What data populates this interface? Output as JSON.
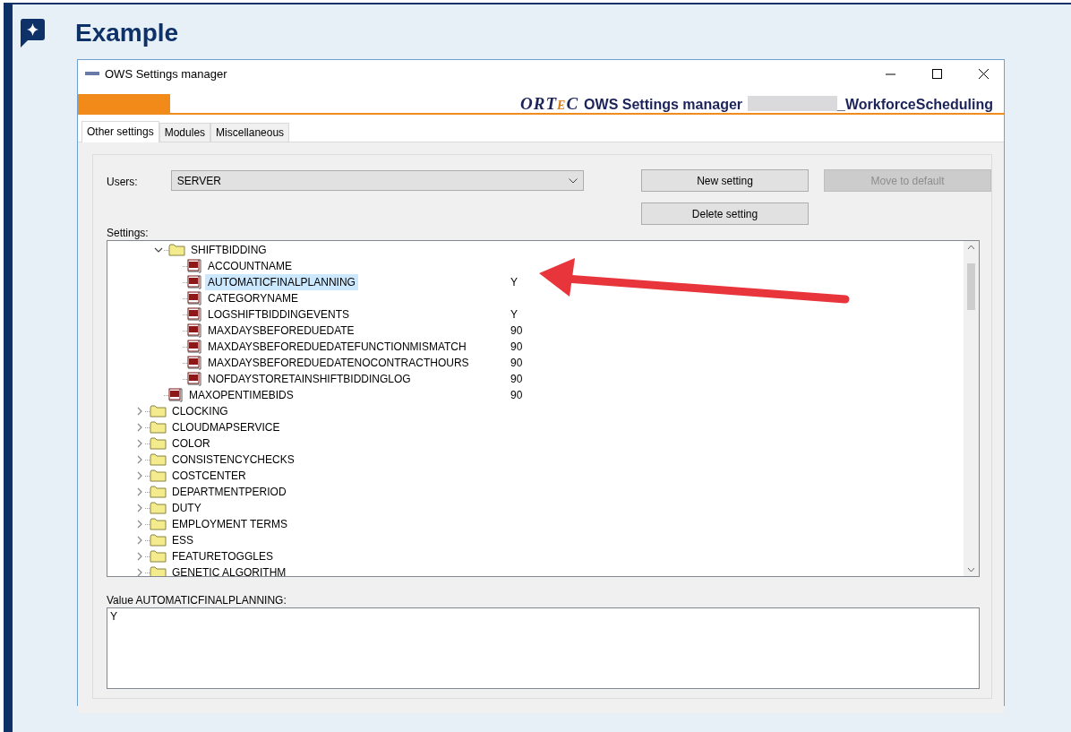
{
  "callout": {
    "title": "Example"
  },
  "window": {
    "title": "OWS Settings manager",
    "logo": "ORTEC",
    "header_title": "OWS Settings manager",
    "header_suffix": "_WorkforceScheduling"
  },
  "tabs": [
    {
      "label": "Other settings",
      "selected": true
    },
    {
      "label": "Modules",
      "selected": false
    },
    {
      "label": "Miscellaneous",
      "selected": false
    }
  ],
  "users": {
    "label": "Users:",
    "value": "SERVER"
  },
  "buttons": [
    {
      "label": "New setting",
      "disabled": false
    },
    {
      "label": "Move to default",
      "disabled": true
    },
    {
      "label": "Delete setting",
      "disabled": false
    }
  ],
  "settings": {
    "label": "Settings:",
    "tree": [
      {
        "kind": "hidden",
        "children": [
          {
            "kind": "folder",
            "label": "SHIFTBIDDING",
            "expanded": true,
            "selected": false,
            "children": [
              {
                "kind": "setting",
                "label": "ACCOUNTNAME",
                "selected": false
              },
              {
                "kind": "setting",
                "label": "AUTOMATICFINALPLANNING",
                "value": "Y",
                "selected": true
              },
              {
                "kind": "setting",
                "label": "CATEGORYNAME",
                "selected": false
              },
              {
                "kind": "setting",
                "label": "LOGSHIFTBIDDINGEVENTS",
                "value": "Y",
                "selected": false
              },
              {
                "kind": "setting",
                "label": "MAXDAYSBEFOREDUEDATE",
                "value": "90",
                "selected": false
              },
              {
                "kind": "setting",
                "label": "MAXDAYSBEFOREDUEDATEFUNCTIONMISMATCH",
                "value": "90",
                "selected": false
              },
              {
                "kind": "setting",
                "label": "MAXDAYSBEFOREDUEDATENOCONTRACTHOURS",
                "value": "90",
                "selected": false
              },
              {
                "kind": "setting",
                "label": "NOFDAYSTORETAINSHIFTBIDDINGLOG",
                "value": "90",
                "selected": false
              }
            ]
          },
          {
            "kind": "setting",
            "label": "MAXOPENTIMEBIDS",
            "value": "90",
            "selected": false
          }
        ]
      },
      {
        "kind": "folder",
        "label": "CLOCKING",
        "expanded": false,
        "selected": false
      },
      {
        "kind": "folder",
        "label": "CLOUDMAPSERVICE",
        "expanded": false,
        "selected": false
      },
      {
        "kind": "folder",
        "label": "COLOR",
        "expanded": false,
        "selected": false
      },
      {
        "kind": "folder",
        "label": "CONSISTENCYCHECKS",
        "expanded": false,
        "selected": false
      },
      {
        "kind": "folder",
        "label": "COSTCENTER",
        "expanded": false,
        "selected": false
      },
      {
        "kind": "folder",
        "label": "DEPARTMENTPERIOD",
        "expanded": false,
        "selected": false
      },
      {
        "kind": "folder",
        "label": "DUTY",
        "expanded": false,
        "selected": false
      },
      {
        "kind": "folder",
        "label": "EMPLOYMENT TERMS",
        "expanded": false,
        "selected": false
      },
      {
        "kind": "folder",
        "label": "ESS",
        "expanded": false,
        "selected": false
      },
      {
        "kind": "folder",
        "label": "FEATURETOGGLES",
        "expanded": false,
        "selected": false
      },
      {
        "kind": "folder",
        "label": "GENETIC ALGORITHM",
        "expanded": false,
        "selected": false
      }
    ]
  },
  "value_box": {
    "label": "Value AUTOMATICFINALPLANNING:",
    "value": "Y"
  }
}
